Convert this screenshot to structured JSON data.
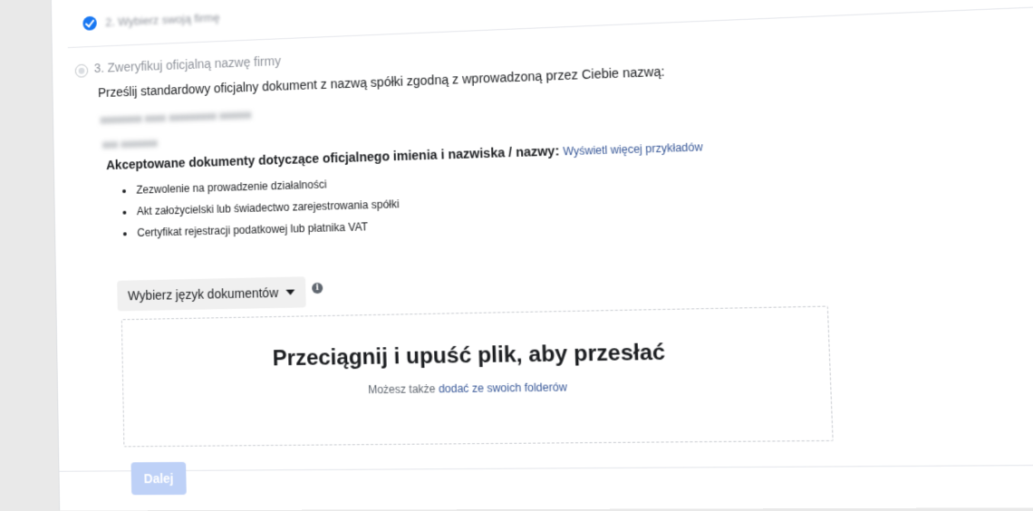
{
  "previous_step": {
    "title": "2. Wybierz swoją firmę",
    "status": "completed"
  },
  "step": {
    "title": "3. Zweryfikuj oficjalną nazwę firmy",
    "instruction": "Prześlij standardowy oficjalny dokument z nazwą spółki zgodną z wprowadzoną przez Ciebie nazwą:",
    "blurred_lines": [
      "xxxxxxxx xxxx xxxxxxxxx xxxxxx",
      "xxx xxxxxxx"
    ],
    "accepted_label": "Akceptowane dokumenty dotyczące oficjalnego imienia i nazwiska / nazwy:",
    "examples_link": "Wyświetl więcej przykładów",
    "documents": [
      "Zezwolenie na prowadzenie działalności",
      "Akt założycielski lub świadectwo zarejestrowania spółki",
      "Certyfikat rejestracji podatkowej lub płatnika VAT"
    ],
    "language_select": "Wybierz język dokumentów",
    "dropzone": {
      "title": "Przeciągnij i upuść plik, aby przesłać",
      "sub_prefix": "Możesz także",
      "sub_link": "dodać ze swoich folderów"
    },
    "next_button": "Dalej"
  },
  "colors": {
    "accent": "#1877f2",
    "link": "#385898",
    "button_disabled": "#bed1f7"
  },
  "icons": [
    "check-circle-icon",
    "radio-icon",
    "caret-down-icon",
    "info-icon"
  ]
}
